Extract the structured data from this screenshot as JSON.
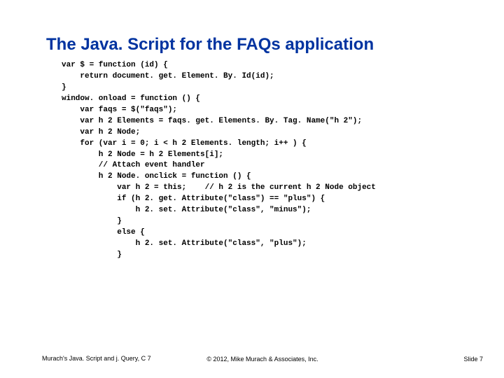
{
  "title": "The Java. Script for the FAQs application",
  "code": "var $ = function (id) {\n    return document. get. Element. By. Id(id);\n}\nwindow. onload = function () {\n    var faqs = $(\"faqs\");\n    var h 2 Elements = faqs. get. Elements. By. Tag. Name(\"h 2\");\n    var h 2 Node;\n    for (var i = 0; i < h 2 Elements. length; i++ ) {\n        h 2 Node = h 2 Elements[i];\n        // Attach event handler\n        h 2 Node. onclick = function () {\n            var h 2 = this;    // h 2 is the current h 2 Node object\n            if (h 2. get. Attribute(\"class\") == \"plus\") {\n                h 2. set. Attribute(\"class\", \"minus\");\n            }\n            else {\n                h 2. set. Attribute(\"class\", \"plus\");\n            }",
  "footer": {
    "left": "Murach's Java. Script and j. Query, C 7",
    "center": "© 2012, Mike Murach & Associates, Inc.",
    "right": "Slide 7"
  }
}
